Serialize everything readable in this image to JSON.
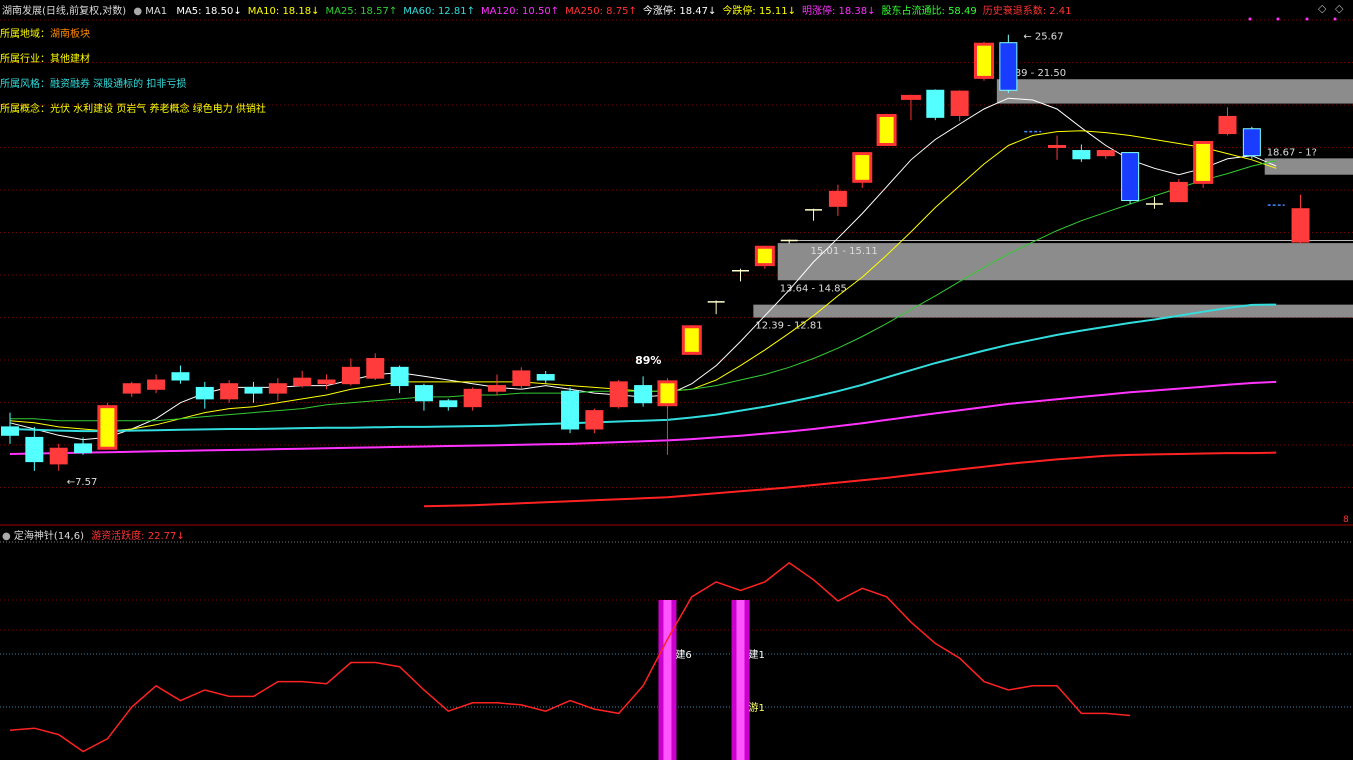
{
  "header": {
    "stock": "湖南发展(日线,前复权,对数)",
    "ma1_label": "MA1",
    "items": [
      {
        "text": "MA5: 18.50↓",
        "color": "#ffffff"
      },
      {
        "text": "MA10: 18.18↓",
        "color": "#ffff00"
      },
      {
        "text": "MA25: 18.57↑",
        "color": "#33cc33"
      },
      {
        "text": "MA60: 12.81↑",
        "color": "#33dddd"
      },
      {
        "text": "MA120: 10.50↑",
        "color": "#ff33ff"
      },
      {
        "text": "MA250: 8.75↑",
        "color": "#ff3333"
      },
      {
        "text": "今涨停: 18.47↓",
        "color": "#ffffff"
      },
      {
        "text": "今跌停: 15.11↓",
        "color": "#ffff00"
      },
      {
        "text": "明涨停: 18.38↓",
        "color": "#ff33ff"
      },
      {
        "text": "股东占流通比: 58.49",
        "color": "#33ff33"
      },
      {
        "text": "历史衰退系数: 2.41",
        "color": "#ff3333"
      }
    ]
  },
  "info_lines": [
    {
      "label": "所属地域：",
      "value": "湖南板块",
      "value_color": "#ff8800"
    },
    {
      "label": "所属行业：",
      "value": "其他建材",
      "value_color": "#ffff00"
    },
    {
      "label": "所属风格：",
      "value": "融资融券 深股通标的 扣非亏损",
      "value_color": "#33dddd"
    },
    {
      "label": "所属概念：",
      "value": "光伏 水利建设 页岩气 养老概念 绿色电力 供销社",
      "value_color": "#ffff00"
    }
  ],
  "corner_icons": [
    "◇",
    "◇"
  ],
  "colors": {
    "up": "#ff3b3b",
    "down": "#54ffff",
    "limit_up_fill": "#ffff00",
    "limit_up_edge": "#ff3333",
    "zone": "#8c8c8c",
    "grid": "#7a0000"
  },
  "chart_data": {
    "type": "candlestick",
    "y_scale": "log",
    "ylim": [
      7.3,
      26.8
    ],
    "candles": [
      {
        "o": 9.35,
        "h": 9.7,
        "l": 8.95,
        "c": 9.15,
        "t": "down"
      },
      {
        "o": 9.1,
        "h": 9.35,
        "l": 8.35,
        "c": 8.55,
        "t": "down"
      },
      {
        "o": 8.5,
        "h": 8.95,
        "l": 8.35,
        "c": 8.85,
        "t": "up"
      },
      {
        "o": 8.75,
        "h": 9.1,
        "l": 8.7,
        "c": 8.95,
        "t": "down"
      },
      {
        "o": 8.85,
        "h": 9.95,
        "l": 8.85,
        "c": 9.85,
        "t": "limit"
      },
      {
        "o": 10.2,
        "h": 10.5,
        "l": 10.1,
        "c": 10.45,
        "t": "up"
      },
      {
        "o": 10.3,
        "h": 10.7,
        "l": 10.2,
        "c": 10.55,
        "t": "up"
      },
      {
        "o": 10.75,
        "h": 10.95,
        "l": 10.45,
        "c": 10.55,
        "t": "down"
      },
      {
        "o": 10.35,
        "h": 10.5,
        "l": 9.8,
        "c": 10.05,
        "t": "down"
      },
      {
        "o": 10.05,
        "h": 10.55,
        "l": 9.95,
        "c": 10.45,
        "t": "up"
      },
      {
        "o": 10.35,
        "h": 10.5,
        "l": 9.95,
        "c": 10.2,
        "t": "down"
      },
      {
        "o": 10.2,
        "h": 10.6,
        "l": 10.0,
        "c": 10.45,
        "t": "up"
      },
      {
        "o": 10.4,
        "h": 10.8,
        "l": 10.35,
        "c": 10.6,
        "t": "up"
      },
      {
        "o": 10.45,
        "h": 10.7,
        "l": 10.3,
        "c": 10.55,
        "t": "up"
      },
      {
        "o": 10.45,
        "h": 11.15,
        "l": 10.4,
        "c": 10.9,
        "t": "up"
      },
      {
        "o": 10.6,
        "h": 11.3,
        "l": 10.55,
        "c": 11.15,
        "t": "up"
      },
      {
        "o": 10.9,
        "h": 10.95,
        "l": 10.2,
        "c": 10.4,
        "t": "down"
      },
      {
        "o": 10.4,
        "h": 10.45,
        "l": 9.75,
        "c": 10.0,
        "t": "down"
      },
      {
        "o": 10.0,
        "h": 10.05,
        "l": 9.75,
        "c": 9.85,
        "t": "down"
      },
      {
        "o": 9.85,
        "h": 10.35,
        "l": 9.75,
        "c": 10.3,
        "t": "up"
      },
      {
        "o": 10.25,
        "h": 10.7,
        "l": 10.15,
        "c": 10.4,
        "t": "up"
      },
      {
        "o": 10.4,
        "h": 10.9,
        "l": 10.3,
        "c": 10.8,
        "t": "up"
      },
      {
        "o": 10.7,
        "h": 10.8,
        "l": 10.45,
        "c": 10.55,
        "t": "down"
      },
      {
        "o": 10.25,
        "h": 10.35,
        "l": 9.2,
        "c": 9.3,
        "t": "down"
      },
      {
        "o": 9.3,
        "h": 9.8,
        "l": 9.2,
        "c": 9.75,
        "t": "up"
      },
      {
        "o": 9.85,
        "h": 10.55,
        "l": 9.8,
        "c": 10.5,
        "t": "up"
      },
      {
        "o": 10.4,
        "h": 10.65,
        "l": 9.85,
        "c": 9.95,
        "t": "down"
      },
      {
        "o": 9.9,
        "h": 10.6,
        "l": 8.7,
        "c": 10.5,
        "t": "limit"
      },
      {
        "o": 11.3,
        "h": 12.15,
        "l": 11.3,
        "c": 12.1,
        "t": "limit"
      },
      {
        "o": 12.85,
        "h": 12.95,
        "l": 12.5,
        "c": 12.9,
        "t": "tick"
      },
      {
        "o": 13.95,
        "h": 14.05,
        "l": 13.6,
        "c": 13.98,
        "t": "tick"
      },
      {
        "o": 14.2,
        "h": 14.9,
        "l": 14.05,
        "c": 14.85,
        "t": "limit"
      },
      {
        "o": 15.05,
        "h": 15.15,
        "l": 15.0,
        "c": 15.11,
        "t": "tick"
      },
      {
        "o": 16.3,
        "h": 16.4,
        "l": 15.9,
        "c": 16.35,
        "t": "tick"
      },
      {
        "o": 16.5,
        "h": 17.45,
        "l": 16.1,
        "c": 17.15,
        "t": "up"
      },
      {
        "o": 17.6,
        "h": 18.95,
        "l": 17.3,
        "c": 18.9,
        "t": "limit"
      },
      {
        "o": 19.35,
        "h": 20.95,
        "l": 19.35,
        "c": 20.85,
        "t": "limit"
      },
      {
        "o": 21.8,
        "h": 22.0,
        "l": 20.6,
        "c": 21.9,
        "t": "limit"
      },
      {
        "o": 22.25,
        "h": 22.3,
        "l": 20.6,
        "c": 20.75,
        "t": "down"
      },
      {
        "o": 20.85,
        "h": 22.25,
        "l": 20.55,
        "c": 22.2,
        "t": "up"
      },
      {
        "o": 23.0,
        "h": 25.2,
        "l": 22.8,
        "c": 25.05,
        "t": "limit"
      },
      {
        "o": 25.15,
        "h": 25.67,
        "l": 22.1,
        "c": 22.25,
        "t": "blue"
      },
      {
        "o": 20.0,
        "h": 20.4,
        "l": 19.9,
        "c": 20.0,
        "t": "bluedash"
      },
      {
        "o": 19.2,
        "h": 19.8,
        "l": 18.6,
        "c": 19.3,
        "t": "up"
      },
      {
        "o": 19.05,
        "h": 19.35,
        "l": 18.5,
        "c": 18.65,
        "t": "down"
      },
      {
        "o": 18.8,
        "h": 19.05,
        "l": 18.65,
        "c": 19.05,
        "t": "up"
      },
      {
        "o": 18.95,
        "h": 18.95,
        "l": 16.6,
        "c": 16.75,
        "t": "blue"
      },
      {
        "o": 16.6,
        "h": 16.9,
        "l": 16.4,
        "c": 16.6,
        "t": "tick"
      },
      {
        "o": 16.7,
        "h": 17.7,
        "l": 16.7,
        "c": 17.55,
        "t": "up"
      },
      {
        "o": 17.55,
        "h": 19.5,
        "l": 17.3,
        "c": 19.45,
        "t": "limit"
      },
      {
        "o": 19.9,
        "h": 21.3,
        "l": 19.8,
        "c": 20.8,
        "t": "up"
      },
      {
        "o": 20.15,
        "h": 20.25,
        "l": 18.65,
        "c": 18.8,
        "t": "blue"
      },
      {
        "o": 16.55,
        "h": 16.6,
        "l": 16.45,
        "c": 16.55,
        "t": "bluedash"
      },
      {
        "o": 15.05,
        "h": 17.0,
        "l": 15.0,
        "c": 16.4,
        "t": "up"
      }
    ],
    "ma_lines": [
      {
        "name": "MA5",
        "color": "#ffffff",
        "values": [
          9.45,
          9.3,
          9.15,
          9.05,
          9.1,
          9.3,
          9.55,
          9.95,
          10.2,
          10.35,
          10.35,
          10.35,
          10.4,
          10.4,
          10.55,
          10.7,
          10.75,
          10.65,
          10.55,
          10.45,
          10.35,
          10.3,
          10.4,
          10.3,
          10.2,
          10.15,
          10.1,
          10.15,
          10.45,
          10.95,
          11.65,
          12.45,
          13.3,
          14.3,
          15.2,
          16.2,
          17.35,
          18.6,
          19.6,
          20.4,
          21.2,
          21.8,
          21.7,
          21.2,
          20.2,
          19.3,
          18.6,
          18.2,
          17.9,
          18.2,
          18.65,
          18.8,
          18.3
        ]
      },
      {
        "name": "MA10",
        "color": "#ffff00",
        "values": [
          9.5,
          9.45,
          9.35,
          9.3,
          9.25,
          9.3,
          9.4,
          9.55,
          9.7,
          9.8,
          9.85,
          9.95,
          10.05,
          10.15,
          10.3,
          10.4,
          10.5,
          10.5,
          10.5,
          10.5,
          10.5,
          10.5,
          10.45,
          10.4,
          10.35,
          10.3,
          10.25,
          10.25,
          10.3,
          10.55,
          10.95,
          11.4,
          11.9,
          12.45,
          13.1,
          13.75,
          14.55,
          15.45,
          16.45,
          17.4,
          18.4,
          19.3,
          19.8,
          20.0,
          20.05,
          19.95,
          19.8,
          19.6,
          19.4,
          19.2,
          18.9,
          18.6,
          18.2
        ]
      },
      {
        "name": "MA25",
        "color": "#33cc33",
        "values": [
          9.55,
          9.55,
          9.5,
          9.5,
          9.5,
          9.5,
          9.5,
          9.55,
          9.6,
          9.65,
          9.7,
          9.75,
          9.8,
          9.9,
          9.95,
          10.0,
          10.05,
          10.1,
          10.1,
          10.15,
          10.15,
          10.2,
          10.2,
          10.2,
          10.25,
          10.25,
          10.25,
          10.25,
          10.3,
          10.4,
          10.55,
          10.7,
          10.9,
          11.15,
          11.45,
          11.8,
          12.2,
          12.65,
          13.1,
          13.6,
          14.1,
          14.6,
          15.05,
          15.5,
          15.9,
          16.25,
          16.6,
          16.95,
          17.3,
          17.65,
          17.95,
          18.3,
          18.57
        ]
      },
      {
        "name": "MA60",
        "color": "#33dddd",
        "values": [
          9.3,
          9.28,
          9.26,
          9.25,
          9.25,
          9.26,
          9.27,
          9.28,
          9.29,
          9.3,
          9.3,
          9.31,
          9.32,
          9.33,
          9.33,
          9.34,
          9.35,
          9.35,
          9.36,
          9.37,
          9.38,
          9.4,
          9.42,
          9.44,
          9.46,
          9.48,
          9.5,
          9.52,
          9.58,
          9.65,
          9.75,
          9.85,
          9.97,
          10.1,
          10.25,
          10.42,
          10.62,
          10.82,
          11.02,
          11.2,
          11.38,
          11.55,
          11.7,
          11.85,
          11.98,
          12.1,
          12.22,
          12.33,
          12.45,
          12.58,
          12.7,
          12.8,
          12.81
        ]
      },
      {
        "name": "MA120",
        "color": "#ff33ff",
        "values": [
          8.72,
          8.73,
          8.74,
          8.75,
          8.76,
          8.77,
          8.78,
          8.79,
          8.8,
          8.81,
          8.82,
          8.83,
          8.84,
          8.85,
          8.86,
          8.87,
          8.88,
          8.89,
          8.9,
          8.91,
          8.92,
          8.93,
          8.94,
          8.95,
          8.97,
          8.99,
          9.01,
          9.03,
          9.06,
          9.1,
          9.14,
          9.19,
          9.24,
          9.3,
          9.37,
          9.44,
          9.52,
          9.6,
          9.68,
          9.76,
          9.84,
          9.92,
          9.98,
          10.04,
          10.1,
          10.16,
          10.22,
          10.27,
          10.32,
          10.37,
          10.42,
          10.47,
          10.5
        ]
      },
      {
        "name": "MA250",
        "color": "#ff2222",
        "start": 17,
        "values": [
          7.62,
          7.63,
          7.64,
          7.66,
          7.68,
          7.7,
          7.72,
          7.74,
          7.76,
          7.78,
          7.8,
          7.84,
          7.88,
          7.92,
          7.96,
          8.0,
          8.05,
          8.1,
          8.15,
          8.2,
          8.26,
          8.32,
          8.38,
          8.44,
          8.5,
          8.55,
          8.6,
          8.64,
          8.68,
          8.7,
          8.71,
          8.72,
          8.73,
          8.74,
          8.74,
          8.75
        ]
      }
    ],
    "zones": [
      {
        "low": 21.5,
        "high": 22.89,
        "label": "22.89 - 21.50",
        "start": 41
      },
      {
        "low": 17.9,
        "high": 18.67,
        "label": "18.67 - 1?",
        "start": 52
      },
      {
        "low": 13.64,
        "high": 15.01,
        "label": "13.64 - 14.85",
        "start": 32
      },
      {
        "low": 12.39,
        "high": 12.81,
        "label": "12.39 - 12.81",
        "start": 31
      }
    ],
    "line_labels": [
      {
        "text": "15.01 - 15.11",
        "price": 15.06,
        "idx": 33
      },
      {
        "text": "25.67",
        "price": 25.67,
        "idx": 41
      },
      {
        "text": "7.57",
        "price": 8.35,
        "idx": 2
      },
      {
        "text": "89%",
        "price": 11.0,
        "idx": 26
      }
    ],
    "limit_price_line": 15.11,
    "right_tag": "8"
  },
  "sub_chart": {
    "title": "定海神针(14,6)",
    "metric_label": "游资活跃度: 22.77↓",
    "ylim": [
      0,
      100
    ],
    "line_color": "#ff2222",
    "values": [
      14,
      15,
      12,
      4,
      10,
      25,
      35,
      28,
      33,
      30,
      30,
      37,
      37,
      36,
      46,
      46,
      44,
      33,
      23,
      27,
      27,
      26,
      23,
      28,
      24,
      22,
      35,
      57,
      77,
      84,
      80,
      84,
      93,
      85,
      75,
      81,
      77,
      65,
      55,
      48,
      37,
      33,
      35,
      35,
      22,
      22,
      21
    ],
    "bars": [
      {
        "idx": 27,
        "label": "建6"
      },
      {
        "idx": 30,
        "label": "建1"
      }
    ],
    "bar_labels_extra": [
      {
        "idx": 30,
        "text": "游1"
      }
    ],
    "ref_lines": [
      {
        "value": 50,
        "color": "#3a7fa8"
      },
      {
        "value": 25,
        "color": "#3a7fa8"
      }
    ]
  }
}
